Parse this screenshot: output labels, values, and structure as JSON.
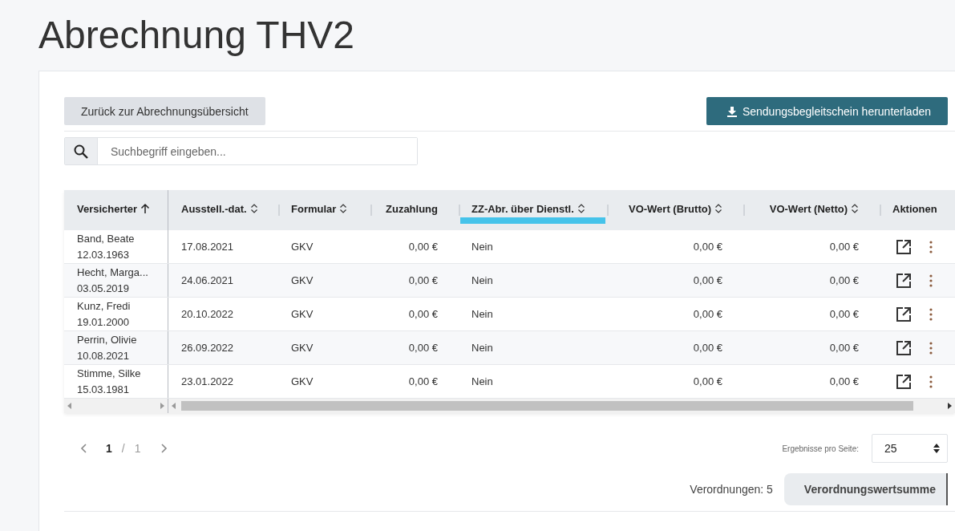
{
  "title": "Abrechnung THV2",
  "back_button": "Zurück zur Abrechnungsübersicht",
  "download_button": "Sendungsbegleitschein herunterladen",
  "search": {
    "placeholder": "Suchbegriff eingeben..."
  },
  "table": {
    "columns": [
      {
        "label": "Versicherter",
        "kind": "text",
        "sortable": true,
        "sorted": true,
        "highlighted": false
      },
      {
        "label": "Ausstell.-dat.",
        "kind": "text",
        "sortable": true,
        "sorted": false,
        "highlighted": false
      },
      {
        "label": "Formular",
        "kind": "text",
        "sortable": true,
        "sorted": false,
        "highlighted": false
      },
      {
        "label": "Zuzahlung",
        "kind": "money",
        "sortable": false,
        "sorted": false,
        "highlighted": false
      },
      {
        "label": "ZZ-Abr. über Dienstl.",
        "kind": "text",
        "sortable": true,
        "sorted": false,
        "highlighted": true
      },
      {
        "label": "VO-Wert (Brutto)",
        "kind": "money",
        "sortable": true,
        "sorted": false,
        "highlighted": false
      },
      {
        "label": "VO-Wert (Netto)",
        "kind": "money",
        "sortable": true,
        "sorted": false,
        "highlighted": false
      },
      {
        "label": "Aktionen",
        "kind": "actions",
        "sortable": false,
        "sorted": false,
        "highlighted": false
      }
    ],
    "rows": [
      {
        "name": "Band, Beate",
        "birth": "12.03.1963",
        "date": "17.08.2021",
        "form": "GKV",
        "copay": "0,00 €",
        "zz": "Nein",
        "gross": "0,00 €",
        "net": "0,00 €"
      },
      {
        "name": "Hecht, Marga...",
        "birth": "03.05.2019",
        "date": "24.06.2021",
        "form": "GKV",
        "copay": "0,00 €",
        "zz": "Nein",
        "gross": "0,00 €",
        "net": "0,00 €"
      },
      {
        "name": "Kunz, Fredi",
        "birth": "19.01.2000",
        "date": "20.10.2022",
        "form": "GKV",
        "copay": "0,00 €",
        "zz": "Nein",
        "gross": "0,00 €",
        "net": "0,00 €"
      },
      {
        "name": "Perrin, Olivie",
        "birth": "10.08.2021",
        "date": "26.09.2022",
        "form": "GKV",
        "copay": "0,00 €",
        "zz": "Nein",
        "gross": "0,00 €",
        "net": "0,00 €"
      },
      {
        "name": "Stimme, Silke",
        "birth": "15.03.1981",
        "date": "23.01.2022",
        "form": "GKV",
        "copay": "0,00 €",
        "zz": "Nein",
        "gross": "0,00 €",
        "net": "0,00 €"
      }
    ]
  },
  "pagination": {
    "current": "1",
    "separator": "/",
    "total": "1"
  },
  "page_size": {
    "label": "Ergebnisse pro Seite:",
    "value": "25"
  },
  "count": "Verordnungen: 5",
  "sum_button": "Verordnungswertsumme"
}
